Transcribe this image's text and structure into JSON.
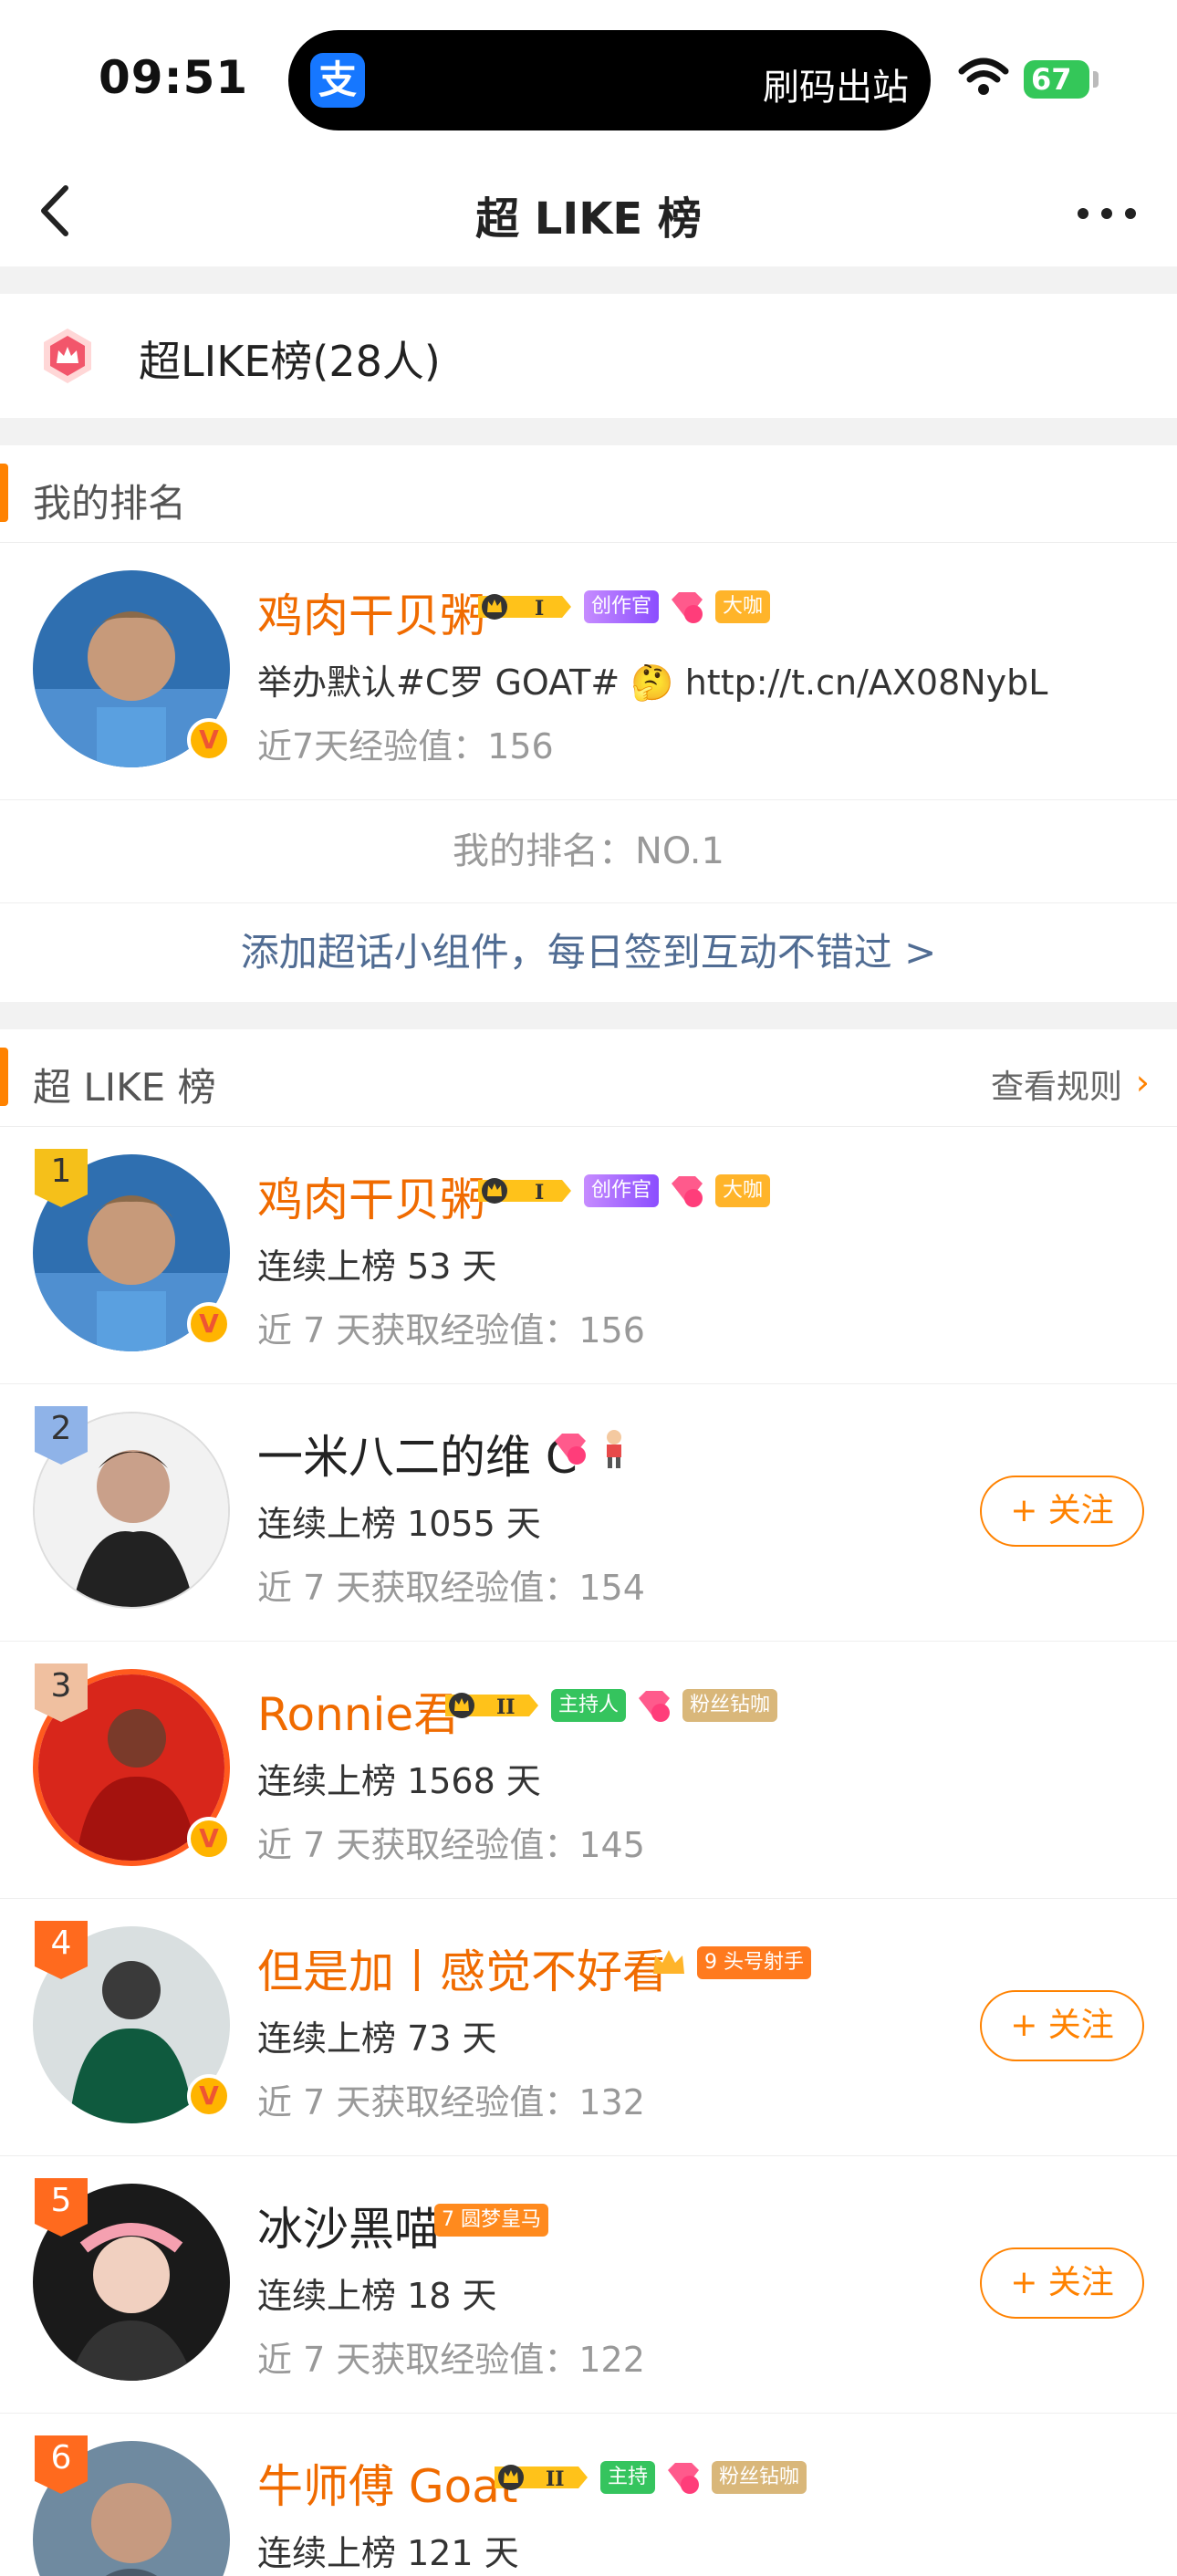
{
  "status": {
    "time": "09:51",
    "island_label": "刷码出站",
    "alipay_glyph": "支",
    "battery": "67"
  },
  "nav": {
    "title": "超 LIKE 榜"
  },
  "summary": {
    "text": "超LIKE榜(28人)"
  },
  "my_section": {
    "title": "我的排名",
    "name": "鸡肉干贝粥",
    "badges": [
      "创作官",
      "大咖"
    ],
    "gem_level": "12",
    "bio": "举办默认#C罗 GOAT# 🤔 http://t.cn/AX08NybL",
    "exp": "近7天经验值：156",
    "rank_text": "我的排名：NO.1",
    "widget_link": "添加超话小组件，每日签到互动不错过 >"
  },
  "list_section": {
    "title": "超 LIKE 榜",
    "rules": "查看规则",
    "follow_label": "+ 关注",
    "items": [
      {
        "rank": "1",
        "name": "鸡肉干贝粥",
        "streak": "连续上榜 53 天",
        "exp": "近 7 天获取经验值：156",
        "badge_a": "创作官",
        "badge_b": "大咖",
        "gem": "12",
        "crown": "I"
      },
      {
        "rank": "2",
        "name": "一米八二的维 C",
        "streak": "连续上榜 1055 天",
        "exp": "近 7 天获取经验值：154",
        "gem": "14"
      },
      {
        "rank": "3",
        "name": "Ronnie君",
        "streak": "连续上榜 1568 天",
        "exp": "近 7 天获取经验值：145",
        "badge_a": "主持人",
        "badge_b": "粉丝钻咖",
        "gem": "16",
        "crown": "II"
      },
      {
        "rank": "4",
        "name": "但是加丨感觉不好看",
        "streak": "连续上榜 73 天",
        "exp": "近 7 天获取经验值：132",
        "badge_a": "头号射手",
        "level": "9"
      },
      {
        "rank": "5",
        "name": "冰沙黑喵",
        "streak": "连续上榜 18 天",
        "exp": "近 7 天获取经验值：122",
        "badge_a": "圆梦皇马",
        "level": "7"
      },
      {
        "rank": "6",
        "name": "牛师傅 Goat",
        "streak": "连续上榜 121 天",
        "badge_a": "主持",
        "badge_b": "粉丝钻咖",
        "gem": "16",
        "crown": "II"
      }
    ]
  },
  "colors": {
    "accent": "#ff8200",
    "vip_name": "#f06b00",
    "link": "#506c93",
    "bg_gap": "#f2f2f2"
  }
}
